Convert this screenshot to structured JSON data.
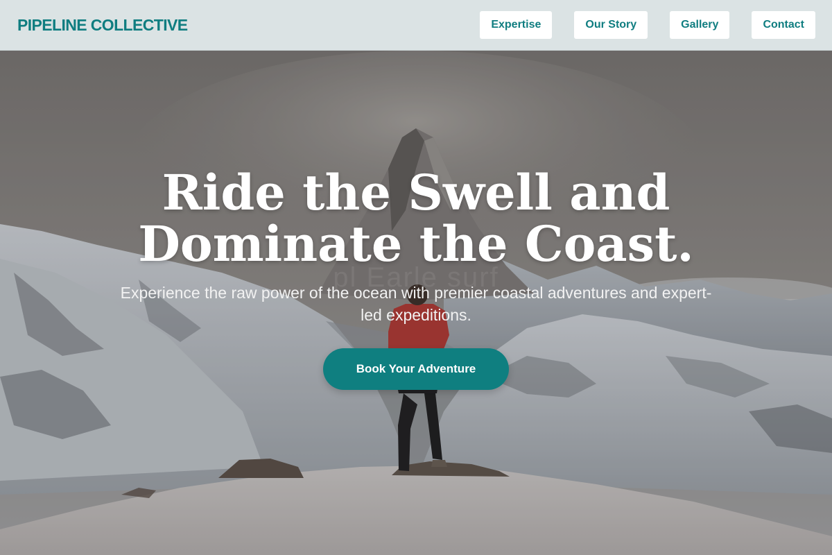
{
  "header": {
    "brand": "PIPELINE COLLECTIVE",
    "nav": [
      {
        "label": "Expertise"
      },
      {
        "label": "Our Story"
      },
      {
        "label": "Gallery"
      },
      {
        "label": "Contact"
      }
    ]
  },
  "hero": {
    "title_line1": "Ride the Swell and",
    "title_line2": "Dominate the Coast.",
    "subtitle": "Experience the raw power of the ocean with premier coastal adventures and expert-led expeditions.",
    "cta_label": "Book Your Adventure",
    "watermark": "pl    Earle surf"
  },
  "colors": {
    "accent": "#0f7d80",
    "header_bg": "#dbe3e4",
    "cta_bg": "#0f7f80"
  }
}
